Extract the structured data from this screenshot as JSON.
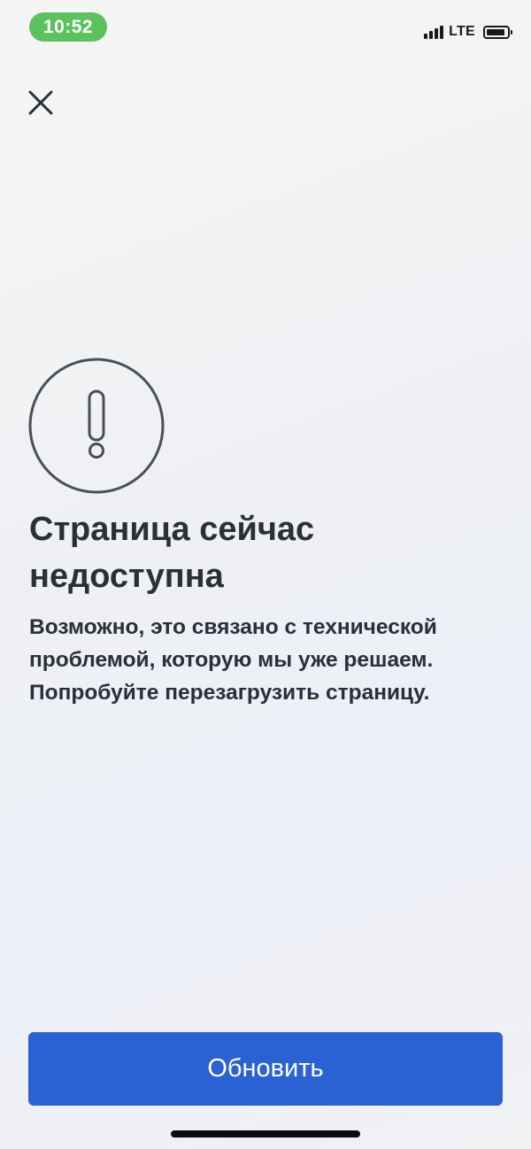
{
  "status_bar": {
    "time": "10:52",
    "network": "LTE",
    "colors": {
      "time_pill": "#5cc15f"
    },
    "icons": [
      "signal-icon",
      "battery-icon"
    ]
  },
  "header": {
    "close_icon": "close-icon"
  },
  "error": {
    "icon": "exclamation-circle-icon",
    "title": "Страница сейчас\nнедоступна",
    "description": "Возможно, это связано с технической\nпроблемой, которую мы уже решаем.\nПопробуйте перезагрузить страницу."
  },
  "actions": {
    "refresh_label": "Обновить",
    "colors": {
      "primary": "#2a62d4"
    }
  }
}
